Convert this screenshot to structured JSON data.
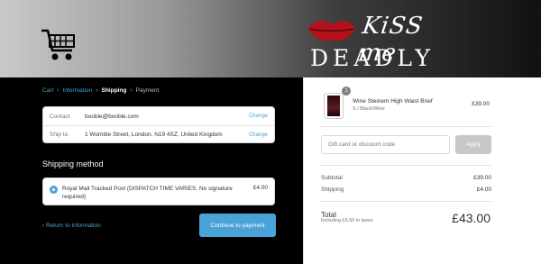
{
  "header": {
    "logo_text_top": "KiSS me",
    "logo_text_bottom": "DEADLY"
  },
  "breadcrumb": {
    "items": [
      "Cart",
      "Information",
      "Shipping",
      "Payment"
    ]
  },
  "contact": {
    "label": "Contact",
    "value": "booble@booble.com",
    "change_label": "Change"
  },
  "ship_to": {
    "label": "Ship to",
    "value": "1 Womble Street, London, N19 4SZ, United Kingdom",
    "change_label": "Change"
  },
  "shipping_method": {
    "title": "Shipping method",
    "option_name": "Royal Mail Tracked Post (DISPATCH TIME VARIES. No signature required)",
    "option_price": "£4.00"
  },
  "actions": {
    "return_label": "Return to information",
    "continue_label": "Continue to payment"
  },
  "order": {
    "quantity": "1",
    "product_name": "Wine Steinem High Waist Brief",
    "product_variant": "S / Black/Wine",
    "product_price": "£39.00",
    "gift_placeholder": "Gift card or discount code",
    "apply_label": "Apply",
    "subtotal_label": "Subtotal",
    "subtotal_value": "£39.00",
    "shipping_label": "Shipping",
    "shipping_value": "£4.00",
    "total_label": "Total",
    "tax_note": "Including £6.50 in taxes",
    "total_value": "£43.00"
  },
  "colors": {
    "accent": "#4aa3d8",
    "left_pane_bg": "#000000",
    "apply_disabled": "#c8c8c8"
  }
}
